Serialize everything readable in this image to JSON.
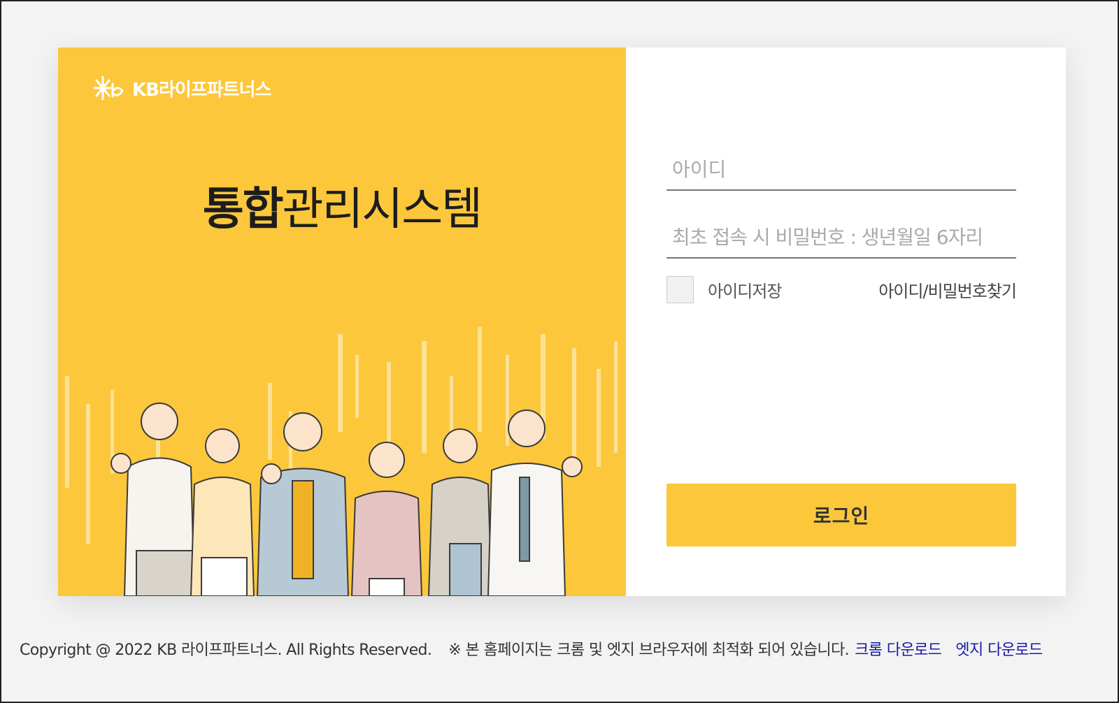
{
  "brand": {
    "logo_text": "KB라이프파트너스",
    "headline_bold": "통합",
    "headline_light": "관리시스템"
  },
  "login": {
    "id_placeholder": "아이디",
    "pw_placeholder": "최초 접속 시 비밀번호 : 생년월일 6자리",
    "save_id_label": "아이디저장",
    "find_link": "아이디/비밀번호찾기",
    "login_button": "로그인"
  },
  "footer": {
    "copyright": "Copyright @ 2022 KB 라이프파트너스. All Rights Reserved.",
    "notice": "※ 본 홈페이지는 크롬 및 엣지 브라우저에 최적화 되어 있습니다.",
    "chrome_link": "크롬 다운로드",
    "edge_link": "엣지 다운로드"
  },
  "colors": {
    "accent": "#fdc73c",
    "link": "#1a1aa8"
  }
}
